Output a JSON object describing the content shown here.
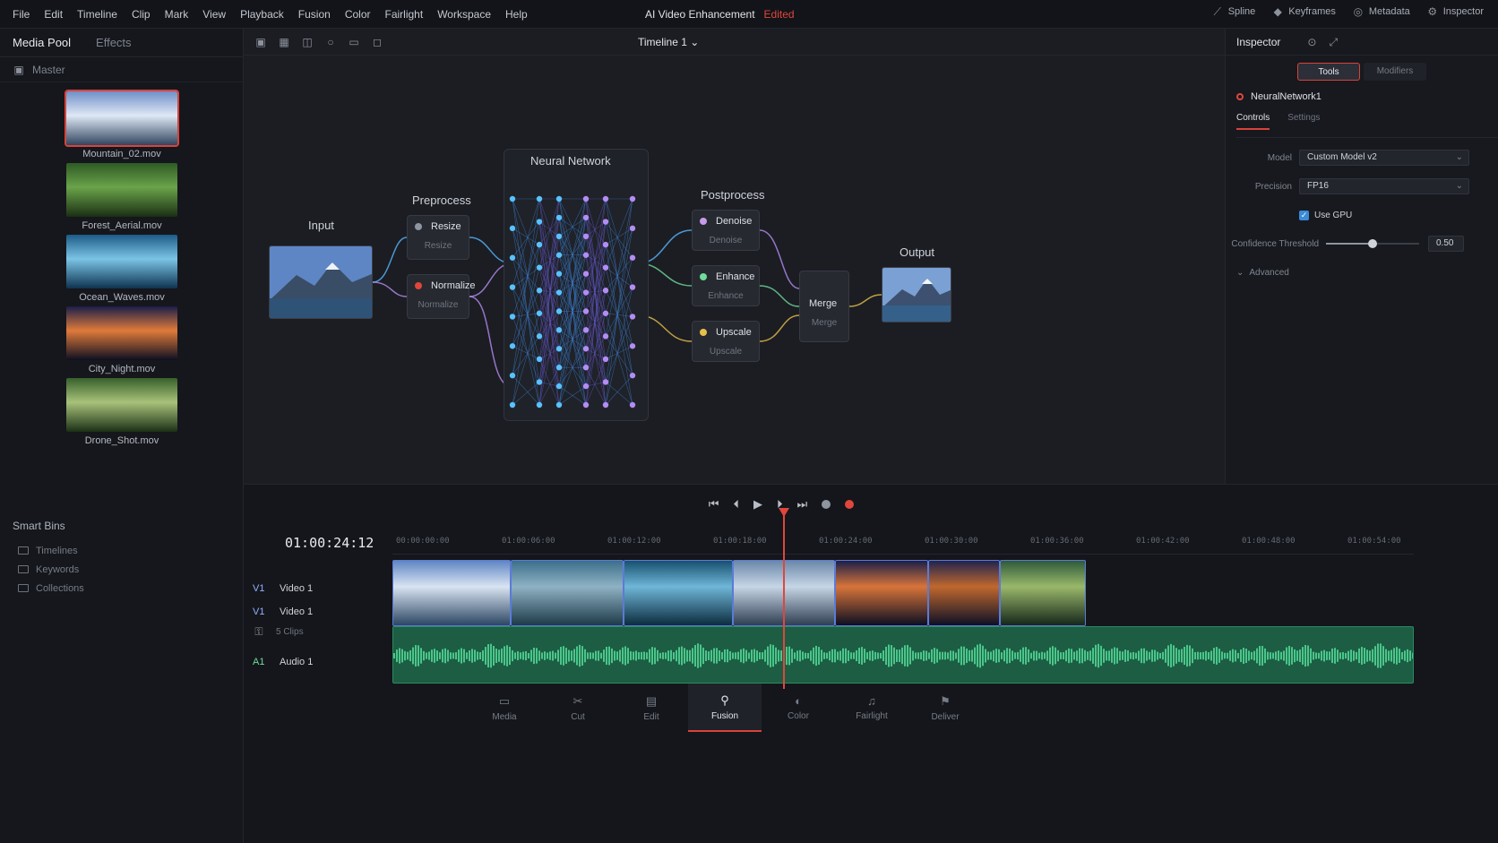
{
  "menu": [
    "File",
    "Edit",
    "Timeline",
    "Clip",
    "Mark",
    "View",
    "Playback",
    "Fusion",
    "Color",
    "Fairlight",
    "Workspace",
    "Help"
  ],
  "project": {
    "title": "AI Video Enhancement",
    "status": "Edited"
  },
  "toolbar_right": [
    {
      "icon": "spline-icon",
      "label": "Spline"
    },
    {
      "icon": "keyframes-icon",
      "label": "Keyframes"
    },
    {
      "icon": "metadata-icon",
      "label": "Metadata"
    },
    {
      "icon": "inspector-icon",
      "label": "Inspector"
    }
  ],
  "media_pool": {
    "tab_active": "Media Pool",
    "tab_inactive": "Effects",
    "bin": "Master",
    "clips": [
      {
        "name": "Mountain_02.mov",
        "selected": true,
        "colors": [
          "#6f90c8",
          "#dfe8f5",
          "#31455f"
        ]
      },
      {
        "name": "Forest_Aerial.mov",
        "selected": false,
        "colors": [
          "#2e5a25",
          "#6aa34a",
          "#1b2f14"
        ]
      },
      {
        "name": "Ocean_Waves.mov",
        "selected": false,
        "colors": [
          "#1d5b86",
          "#7bc4e6",
          "#0e3350"
        ]
      },
      {
        "name": "City_Night.mov",
        "selected": false,
        "colors": [
          "#1a1f4a",
          "#e07a3a",
          "#0d0f22"
        ]
      },
      {
        "name": "Drone_Shot.mov",
        "selected": false,
        "colors": [
          "#37602c",
          "#a8c27a",
          "#1c3015"
        ]
      }
    ]
  },
  "smart_bins": {
    "header": "Smart Bins",
    "items": [
      "Timelines",
      "Keywords",
      "Collections"
    ]
  },
  "timeline": {
    "name": "Timeline 1",
    "timecode": "01:00:24:12"
  },
  "node_graph": {
    "input_label": "Input",
    "preprocess_label": "Preprocess",
    "neural_label": "Neural Network",
    "postprocess_label": "Postprocess",
    "output_label": "Output",
    "pre_nodes": [
      {
        "title": "Resize",
        "sub": "Resize"
      },
      {
        "title": "Normalize",
        "sub": "Normalize"
      }
    ],
    "post_nodes": [
      {
        "title": "Denoise",
        "sub": "Denoise"
      },
      {
        "title": "Enhance",
        "sub": "Enhance"
      },
      {
        "title": "Upscale",
        "sub": "Upscale"
      }
    ],
    "merge_node": {
      "title": "Merge",
      "sub": "Merge"
    }
  },
  "inspector": {
    "title": "Inspector",
    "tab_on": "Tools",
    "tab_off": "Modifiers",
    "node_name": "NeuralNetwork1",
    "sub_on": "Controls",
    "sub_off": "Settings",
    "model_label": "Model",
    "model_value": "Custom Model v2",
    "precision_label": "Precision",
    "precision_value": "FP16",
    "gpu_label": "Use GPU",
    "gpu_checked": true,
    "threshold_label": "Confidence Threshold",
    "threshold_value": "0.50",
    "threshold": 0.5,
    "advanced_label": "Advanced"
  },
  "tracks": {
    "v1_tag": "V1",
    "v1_name": "Video 1",
    "v1b_tag": "V1",
    "v1b_name": "Video 1",
    "clips_label": "5 Clips",
    "a1_tag": "A1",
    "a1_name": "Audio 1"
  },
  "ruler_ticks": [
    "00:00:00:00",
    "01:00:06:00",
    "01:00:12:00",
    "01:00:18:00",
    "01:00:24:00",
    "01:00:30:00",
    "01:00:36:00",
    "01:00:42:00",
    "01:00:48:00",
    "01:00:54:00"
  ],
  "video_clips": [
    {
      "colors": [
        "#5f86c3",
        "#d9e4f2",
        "#2c4663"
      ]
    },
    {
      "colors": [
        "#3c6f8a",
        "#8fb2c4",
        "#1d3a48"
      ]
    },
    {
      "colors": [
        "#18506f",
        "#6fb6d8",
        "#0c2c3e"
      ]
    },
    {
      "colors": [
        "#6b88a8",
        "#c6d6e6",
        "#2f3f52"
      ]
    },
    {
      "colors": [
        "#1b1f48",
        "#d8743a",
        "#0c0e22"
      ]
    },
    {
      "colors": [
        "#20244e",
        "#c0682e",
        "#0d1026"
      ]
    },
    {
      "colors": [
        "#2f5a3a",
        "#9ab86a",
        "#15261a"
      ]
    }
  ],
  "pages": [
    {
      "icon": "media-icon",
      "label": "Media",
      "glyph": "▭",
      "active": false
    },
    {
      "icon": "cut-icon",
      "label": "Cut",
      "glyph": "✂",
      "active": false
    },
    {
      "icon": "edit-icon",
      "label": "Edit",
      "glyph": "▤",
      "active": false
    },
    {
      "icon": "fusion-icon",
      "label": "Fusion",
      "glyph": "⚲",
      "active": true
    },
    {
      "icon": "color-icon",
      "label": "Color",
      "glyph": "◐",
      "active": false
    },
    {
      "icon": "fairlight-icon",
      "label": "Fairlight",
      "glyph": "♫",
      "active": false
    },
    {
      "icon": "deliver-icon",
      "label": "Deliver",
      "glyph": "⚑",
      "active": false
    }
  ],
  "accent": "#d8433b"
}
